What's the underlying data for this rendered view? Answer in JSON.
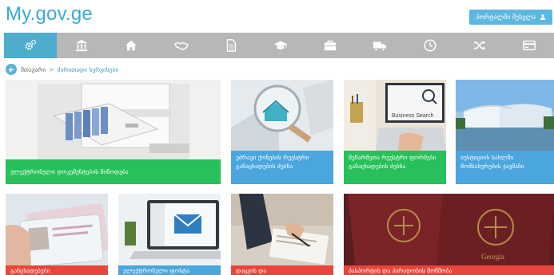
{
  "header": {
    "logo": "My.gov.ge",
    "portal_button": "პორტალში შესვლა"
  },
  "nav": {
    "items": [
      {
        "icon": "cogs-icon",
        "active": true
      },
      {
        "icon": "bank-icon"
      },
      {
        "icon": "home-icon"
      },
      {
        "icon": "handshake-icon"
      },
      {
        "icon": "document-icon"
      },
      {
        "icon": "graduation-cap-icon"
      },
      {
        "icon": "briefcase-icon"
      },
      {
        "icon": "truck-icon"
      },
      {
        "icon": "clock-icon"
      },
      {
        "icon": "shuffle-icon"
      },
      {
        "icon": "credit-card-icon"
      }
    ]
  },
  "breadcrumb": {
    "home": "მთავარი",
    "separator": ">",
    "current": "ძირითადი სერვისები"
  },
  "cards": [
    {
      "title": "ელექტრონული დოკუმენტების მიწოდება",
      "color": "#27c05b",
      "image": "file-cabinet"
    },
    {
      "title": "უძრავი ქონების რეესტრი განაცხადების ძებნა",
      "color": "#4aa6dc",
      "image": "house-magnifier"
    },
    {
      "title": "მეწარმეთა რეესტრი ფორმები განაცხადების ძებნა",
      "color": "#27c05b",
      "image": "business-search"
    },
    {
      "title": "იუსტიციის სახლში მომსახურების ჯავშანი",
      "color": "#4aa6dc",
      "image": "public-service-hall",
      "image_text": "Business Search"
    },
    {
      "title": "განცხადებები",
      "color": "#e9453c",
      "image": "id-cards"
    },
    {
      "title": "ელექტრონული ფოსტა",
      "color": "#4aa6dc",
      "image": "laptop-email"
    },
    {
      "title": "დაცვის და",
      "color": "#e9453c",
      "image": "signing-documents"
    },
    {
      "title": "პასპორტის და პირადობის მოწმობა",
      "color": "#e9453c",
      "image": "georgian-passports",
      "image_text": "Georgia"
    }
  ]
}
